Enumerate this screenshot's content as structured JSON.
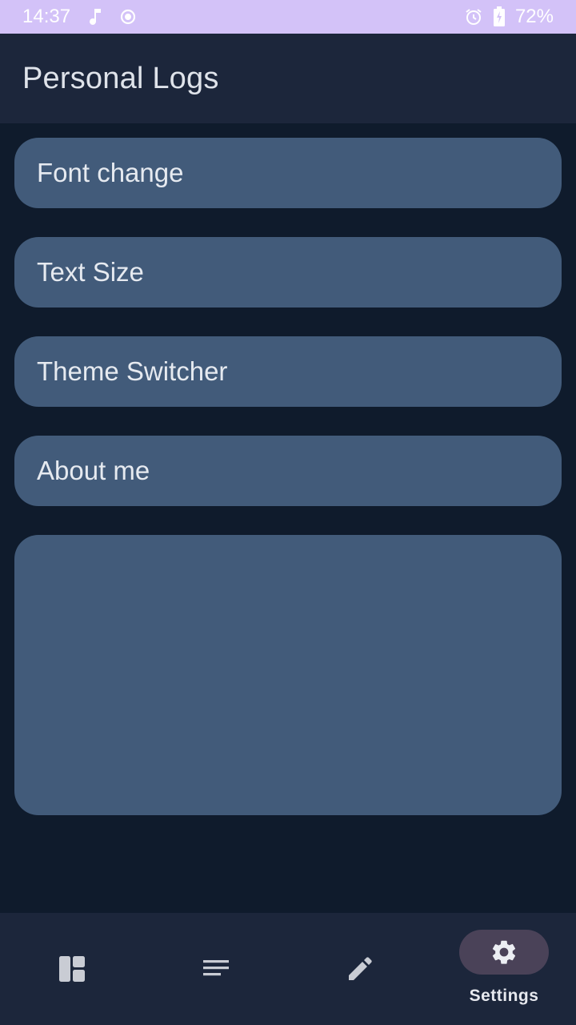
{
  "status_bar": {
    "time": "14:37",
    "battery": "72%"
  },
  "app_bar": {
    "title": "Personal Logs"
  },
  "settings": {
    "items": [
      {
        "label": "Font change"
      },
      {
        "label": "Text Size"
      },
      {
        "label": "Theme Switcher"
      },
      {
        "label": "About me"
      }
    ]
  },
  "bottom_nav": {
    "items": [
      {
        "icon": "dashboard-icon",
        "label": ""
      },
      {
        "icon": "list-icon",
        "label": ""
      },
      {
        "icon": "edit-icon",
        "label": ""
      },
      {
        "icon": "settings-icon",
        "label": "Settings",
        "active": true
      }
    ]
  },
  "colors": {
    "status_bar": "#d3c2f8",
    "app_bar": "#1c263b",
    "background": "#0f1b2c",
    "card": "#425b7a",
    "active_indicator": "#4a4258"
  }
}
